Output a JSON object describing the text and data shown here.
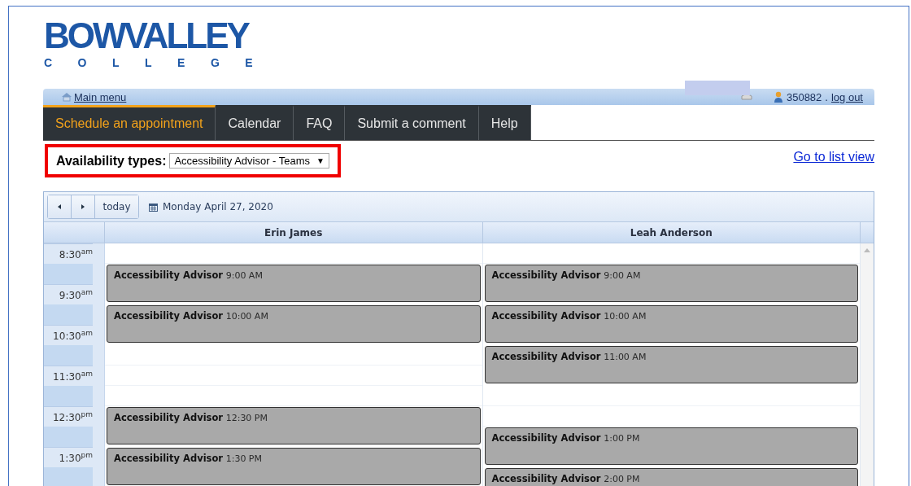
{
  "logo": {
    "wordmark": "BOWVALLEY",
    "subtitle": "COLLEGE"
  },
  "top_bar": {
    "main_menu": "Main menu",
    "user_id": "350882",
    "separator": ".",
    "logout": "log out"
  },
  "tabs": [
    {
      "label": "Schedule an appointment",
      "selected": true
    },
    {
      "label": "Calendar",
      "selected": false
    },
    {
      "label": "FAQ",
      "selected": false
    },
    {
      "label": "Submit a comment",
      "selected": false
    },
    {
      "label": "Help",
      "selected": false
    }
  ],
  "filter": {
    "label": "Availability types:",
    "value": "Accessibility Advisor - Teams",
    "arrow": "▼",
    "highlighted": true
  },
  "list_view_link": "Go to list view",
  "calendar": {
    "today_button": "today",
    "date": "Monday April 27, 2020",
    "times": [
      "8:30$^{am}$",
      "9:30$^{am}$",
      "10:30$^{am}$",
      "11:30$^{am}$",
      "12:30$^{pm}$",
      "1:30$^{pm}$"
    ],
    "columns": [
      {
        "name": "Erin James",
        "slots": [
          {
            "kind": "free"
          },
          {
            "kind": "booking",
            "title": "Accessibility Advisor",
            "time": "9:00 AM"
          },
          {
            "kind": "booking",
            "title": "Accessibility Advisor",
            "time": "10:00 AM"
          },
          {
            "kind": "free"
          },
          {
            "kind": "free"
          },
          {
            "kind": "free"
          },
          {
            "kind": "booking",
            "title": "Accessibility Advisor",
            "time": "12:30 PM"
          },
          {
            "kind": "booking",
            "title": "Accessibility Advisor",
            "time": "1:30 PM"
          }
        ]
      },
      {
        "name": "Leah Anderson",
        "slots": [
          {
            "kind": "free"
          },
          {
            "kind": "booking",
            "title": "Accessibility Advisor",
            "time": "9:00 AM"
          },
          {
            "kind": "booking",
            "title": "Accessibility Advisor",
            "time": "10:00 AM"
          },
          {
            "kind": "booking",
            "title": "Accessibility Advisor",
            "time": "11:00 AM"
          },
          {
            "kind": "free"
          },
          {
            "kind": "free"
          },
          {
            "kind": "booking",
            "title": "Accessibility Advisor",
            "time": "1:00 PM"
          },
          {
            "kind": "booking",
            "title": "Accessibility Advisor",
            "time": "2:00 PM"
          }
        ]
      }
    ]
  }
}
